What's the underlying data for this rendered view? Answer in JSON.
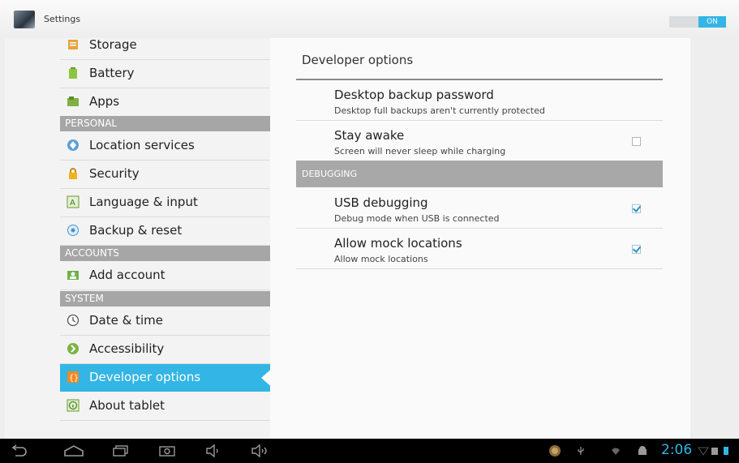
{
  "app": {
    "title": "Settings",
    "toggle_label": "ON"
  },
  "sidebar": {
    "items": [
      {
        "label": "Storage",
        "icon": "storage-icon",
        "kind": "item"
      },
      {
        "label": "Battery",
        "icon": "battery-icon",
        "kind": "item"
      },
      {
        "label": "Apps",
        "icon": "apps-icon",
        "kind": "item"
      },
      {
        "label": "PERSONAL",
        "kind": "header"
      },
      {
        "label": "Location services",
        "icon": "location-icon",
        "kind": "item"
      },
      {
        "label": "Security",
        "icon": "lock-icon",
        "kind": "item"
      },
      {
        "label": "Language & input",
        "icon": "language-icon",
        "kind": "item"
      },
      {
        "label": "Backup & reset",
        "icon": "backup-icon",
        "kind": "item"
      },
      {
        "label": "ACCOUNTS",
        "kind": "header"
      },
      {
        "label": "Add account",
        "icon": "add-account-icon",
        "kind": "item"
      },
      {
        "label": "SYSTEM",
        "kind": "header"
      },
      {
        "label": "Date & time",
        "icon": "clock-icon",
        "kind": "item"
      },
      {
        "label": "Accessibility",
        "icon": "accessibility-icon",
        "kind": "item"
      },
      {
        "label": "Developer options",
        "icon": "developer-icon",
        "kind": "item",
        "selected": true
      },
      {
        "label": "About tablet",
        "icon": "info-icon",
        "kind": "item"
      }
    ]
  },
  "content": {
    "title": "Developer options",
    "prefs": [
      {
        "title": "Desktop backup password",
        "summary": "Desktop full backups aren't currently protected",
        "checkbox": null
      },
      {
        "title": "Stay awake",
        "summary": "Screen will never sleep while charging",
        "checkbox": false
      }
    ],
    "section_header": "DEBUGGING",
    "debug_prefs": [
      {
        "title": "USB debugging",
        "summary": "Debug mode when USB is connected",
        "checkbox": true
      },
      {
        "title": "Allow mock locations",
        "summary": "Allow mock locations",
        "checkbox": true
      }
    ]
  },
  "status_bar": {
    "time": "2:06"
  },
  "colors": {
    "accent": "#33b5e5",
    "header_gray": "#a6a6a6"
  }
}
